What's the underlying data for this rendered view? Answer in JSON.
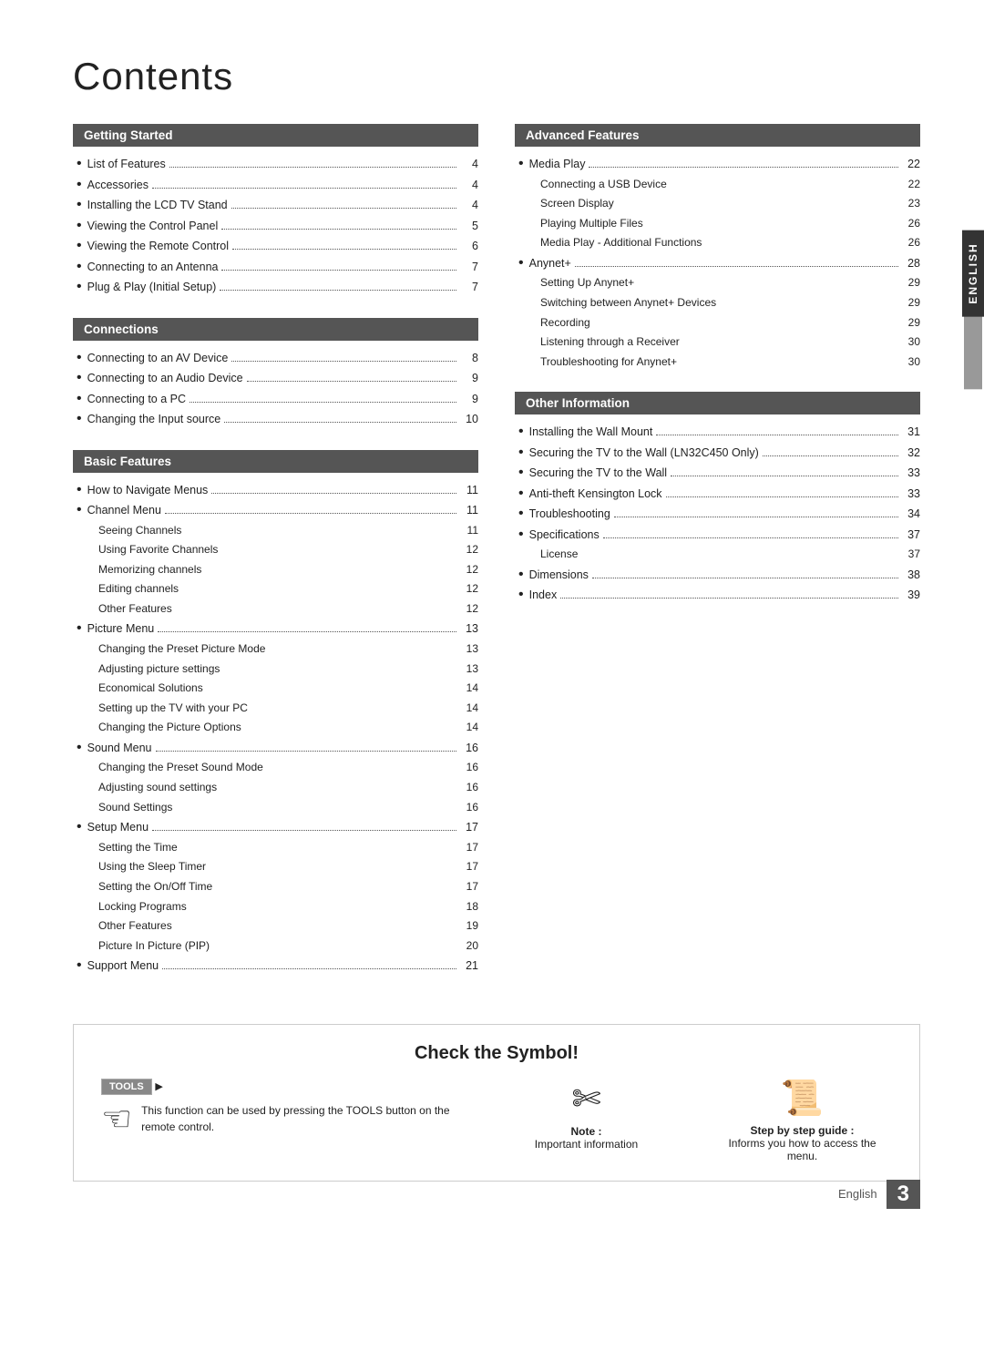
{
  "title": "Contents",
  "left_column": {
    "sections": [
      {
        "id": "getting-started",
        "header": "Getting Started",
        "items": [
          {
            "text": "List of Features",
            "page": "4",
            "has_bullet": true
          },
          {
            "text": "Accessories",
            "page": "4",
            "has_bullet": true
          },
          {
            "text": "Installing the LCD TV Stand",
            "page": "4",
            "has_bullet": true
          },
          {
            "text": "Viewing the Control Panel",
            "page": "5",
            "has_bullet": true
          },
          {
            "text": "Viewing the Remote Control",
            "page": "6",
            "has_bullet": true
          },
          {
            "text": "Connecting to an Antenna",
            "page": "7",
            "has_bullet": true
          },
          {
            "text": "Plug & Play (Initial Setup)",
            "page": "7",
            "has_bullet": true
          }
        ]
      },
      {
        "id": "connections",
        "header": "Connections",
        "items": [
          {
            "text": "Connecting to an AV Device",
            "page": "8",
            "has_bullet": true
          },
          {
            "text": "Connecting to an Audio Device",
            "page": "9",
            "has_bullet": true
          },
          {
            "text": "Connecting to a PC",
            "page": "9",
            "has_bullet": true
          },
          {
            "text": "Changing the Input source",
            "page": "10",
            "has_bullet": true
          }
        ]
      },
      {
        "id": "basic-features",
        "header": "Basic Features",
        "items": [
          {
            "text": "How to Navigate Menus",
            "page": "11",
            "has_bullet": true,
            "sub_items": []
          },
          {
            "text": "Channel Menu",
            "page": "11",
            "has_bullet": true,
            "sub_items": [
              {
                "text": "Seeing Channels",
                "page": "11"
              },
              {
                "text": "Using Favorite Channels",
                "page": "12"
              },
              {
                "text": "Memorizing channels",
                "page": "12"
              },
              {
                "text": "Editing channels",
                "page": "12"
              },
              {
                "text": "Other Features",
                "page": "12"
              }
            ]
          },
          {
            "text": "Picture Menu",
            "page": "13",
            "has_bullet": true,
            "sub_items": [
              {
                "text": "Changing the Preset Picture Mode",
                "page": "13"
              },
              {
                "text": "Adjusting picture settings",
                "page": "13"
              },
              {
                "text": "Economical Solutions",
                "page": "14"
              },
              {
                "text": "Setting up the TV with your PC",
                "page": "14"
              },
              {
                "text": "Changing the Picture Options",
                "page": "14"
              }
            ]
          },
          {
            "text": "Sound Menu",
            "page": "16",
            "has_bullet": true,
            "sub_items": [
              {
                "text": "Changing the Preset Sound Mode",
                "page": "16"
              },
              {
                "text": "Adjusting sound settings",
                "page": "16"
              },
              {
                "text": "Sound Settings",
                "page": "16"
              }
            ]
          },
          {
            "text": "Setup Menu",
            "page": "17",
            "has_bullet": true,
            "sub_items": [
              {
                "text": "Setting the Time",
                "page": "17"
              },
              {
                "text": "Using the Sleep Timer",
                "page": "17"
              },
              {
                "text": "Setting the On/Off Time",
                "page": "17"
              },
              {
                "text": "Locking Programs",
                "page": "18"
              },
              {
                "text": "Other Features",
                "page": "19"
              },
              {
                "text": "Picture In Picture (PIP)",
                "page": "20"
              }
            ]
          },
          {
            "text": "Support Menu",
            "page": "21",
            "has_bullet": true,
            "sub_items": []
          }
        ]
      }
    ]
  },
  "right_column": {
    "sections": [
      {
        "id": "advanced-features",
        "header": "Advanced Features",
        "items": [
          {
            "text": "Media Play",
            "page": "22",
            "has_bullet": true,
            "sub_items": [
              {
                "text": "Connecting a USB Device",
                "page": "22"
              },
              {
                "text": "Screen Display",
                "page": "23"
              },
              {
                "text": "Playing Multiple Files",
                "page": "26"
              },
              {
                "text": "Media Play - Additional Functions",
                "page": "26"
              }
            ]
          },
          {
            "text": "Anynet+",
            "page": "28",
            "has_bullet": true,
            "sub_items": [
              {
                "text": "Setting Up Anynet+",
                "page": "29"
              },
              {
                "text": "Switching between Anynet+ Devices",
                "page": "29"
              },
              {
                "text": "Recording",
                "page": "29"
              },
              {
                "text": "Listening through a Receiver",
                "page": "30"
              },
              {
                "text": "Troubleshooting for Anynet+",
                "page": "30"
              }
            ]
          }
        ]
      },
      {
        "id": "other-information",
        "header": "Other Information",
        "items": [
          {
            "text": "Installing the Wall Mount",
            "page": "31",
            "has_bullet": true
          },
          {
            "text": "Securing the TV to the Wall (LN32C450 Only)",
            "page": "32",
            "has_bullet": true
          },
          {
            "text": "Securing the TV to the Wall",
            "page": "33",
            "has_bullet": true
          },
          {
            "text": "Anti-theft Kensington Lock",
            "page": "33",
            "has_bullet": true
          },
          {
            "text": "Troubleshooting",
            "page": "34",
            "has_bullet": true
          },
          {
            "text": "Specifications",
            "page": "37",
            "has_bullet": true,
            "sub_items": [
              {
                "text": "License",
                "page": "37"
              }
            ]
          },
          {
            "text": "Dimensions",
            "page": "38",
            "has_bullet": true
          },
          {
            "text": "Index",
            "page": "39",
            "has_bullet": true
          }
        ]
      }
    ]
  },
  "check_symbol": {
    "title": "Check the Symbol!",
    "tools_badge": "TOOLS",
    "tools_desc": "This function can be used by pressing the TOOLS button on the remote control.",
    "note_label": "Note :",
    "note_desc": "Important information",
    "guide_label": "Step by step guide :",
    "guide_desc": "Informs you how to access the menu."
  },
  "sidebar": {
    "language": "ENGLISH"
  },
  "footer": {
    "language": "English",
    "page_number": "3"
  }
}
